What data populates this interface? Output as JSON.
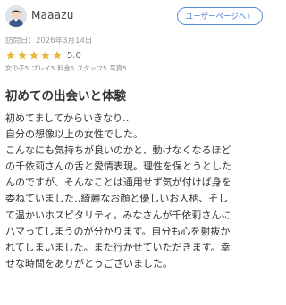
{
  "user": {
    "name": "Maaazu",
    "page_button_label": "ユーザーページへ",
    "page_button_chevron": "〉"
  },
  "visit": {
    "text": "訪問日：2026年3月14日"
  },
  "rating": {
    "value": 5.0,
    "value_text": "5.0",
    "max": 5,
    "star_color": "#e8b53a"
  },
  "sub_ratings": [
    "女の子5",
    "プレイ5",
    "料金5",
    "スタッフ5",
    "写真5"
  ],
  "review": {
    "title": "初めての出会いと体験",
    "lines": [
      "初めてましてからいきなり‥",
      "自分の想像以上の女性でした。",
      "こんなにも気持ちが良いのかと、動けなくなるほど",
      "の千依莉さんの舌と愛情表現。理性を保とうとした",
      "んのですが、そんなことは通用せず気が付けば身を",
      "委ねていました‥綺麗なお顔と優しいお人柄、そし",
      "て温かいホスピタリティ。みなさんが千依莉さんに",
      "ハマってしまうのが分かります。自分も心を射抜か",
      "れてしまいました。また行かせていただきます。幸",
      "せな時間をありがとうございました。"
    ]
  },
  "colors": {
    "accent": "#4a7fcf",
    "text": "#333333",
    "muted": "#9a9a9a"
  }
}
